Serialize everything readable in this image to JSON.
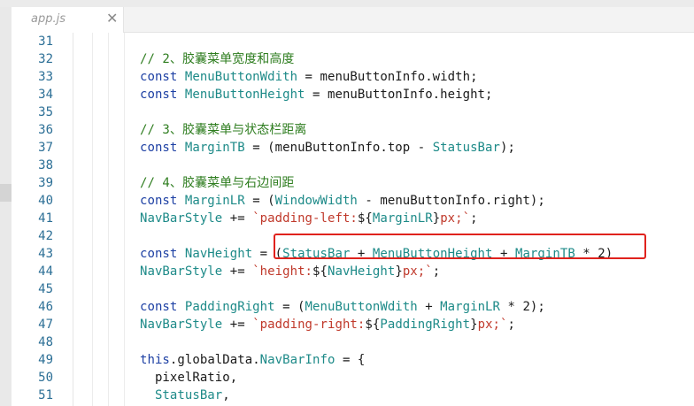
{
  "tab": {
    "title": "app.js",
    "close": "✕"
  },
  "colors": {
    "keyword": "#1c3fa3",
    "identifier": "#1d8a88",
    "string": "#c0392b",
    "comment": "#2e7d1f",
    "plain": "#1a1a1a",
    "line_number": "#2c6f96",
    "highlight_border": "#e0221d"
  },
  "lines": [
    {
      "n": "31",
      "tokens": []
    },
    {
      "n": "32",
      "tokens": [
        {
          "t": "// 2、胶囊菜单宽度和高度",
          "c": "comment"
        }
      ]
    },
    {
      "n": "33",
      "tokens": [
        {
          "t": "const ",
          "c": "keyword"
        },
        {
          "t": "MenuButtonWdith",
          "c": "identifier"
        },
        {
          "t": " = menuButtonInfo.width;",
          "c": "plain"
        }
      ]
    },
    {
      "n": "34",
      "tokens": [
        {
          "t": "const ",
          "c": "keyword"
        },
        {
          "t": "MenuButtonHeight",
          "c": "identifier"
        },
        {
          "t": " = menuButtonInfo.height;",
          "c": "plain"
        }
      ]
    },
    {
      "n": "35",
      "tokens": []
    },
    {
      "n": "36",
      "tokens": [
        {
          "t": "// 3、胶囊菜单与状态栏距离",
          "c": "comment"
        }
      ]
    },
    {
      "n": "37",
      "tokens": [
        {
          "t": "const ",
          "c": "keyword"
        },
        {
          "t": "MarginTB",
          "c": "identifier"
        },
        {
          "t": " = (menuButtonInfo.top - ",
          "c": "plain"
        },
        {
          "t": "StatusBar",
          "c": "identifier"
        },
        {
          "t": ");",
          "c": "plain"
        }
      ]
    },
    {
      "n": "38",
      "tokens": []
    },
    {
      "n": "39",
      "tokens": [
        {
          "t": "// 4、胶囊菜单与右边间距",
          "c": "comment"
        }
      ]
    },
    {
      "n": "40",
      "tokens": [
        {
          "t": "const ",
          "c": "keyword"
        },
        {
          "t": "MarginLR",
          "c": "identifier"
        },
        {
          "t": " = (",
          "c": "plain"
        },
        {
          "t": "WindowWidth",
          "c": "identifier"
        },
        {
          "t": " - menuButtonInfo.right);",
          "c": "plain"
        }
      ]
    },
    {
      "n": "41",
      "tokens": [
        {
          "t": "NavBarStyle",
          "c": "identifier"
        },
        {
          "t": " += ",
          "c": "plain"
        },
        {
          "t": "`padding-left:",
          "c": "string"
        },
        {
          "t": "${",
          "c": "plain"
        },
        {
          "t": "MarginLR",
          "c": "identifier"
        },
        {
          "t": "}",
          "c": "plain"
        },
        {
          "t": "px;`",
          "c": "string"
        },
        {
          "t": ";",
          "c": "plain"
        }
      ]
    },
    {
      "n": "42",
      "tokens": []
    },
    {
      "n": "43",
      "tokens": [
        {
          "t": "const ",
          "c": "keyword"
        },
        {
          "t": "NavHeight",
          "c": "identifier"
        },
        {
          "t": " = (",
          "c": "plain"
        },
        {
          "t": "StatusBar",
          "c": "identifier"
        },
        {
          "t": " + ",
          "c": "plain"
        },
        {
          "t": "MenuButtonHeight",
          "c": "identifier"
        },
        {
          "t": " + ",
          "c": "plain"
        },
        {
          "t": "MarginTB",
          "c": "identifier"
        },
        {
          "t": " * 2)",
          "c": "plain"
        }
      ]
    },
    {
      "n": "44",
      "tokens": [
        {
          "t": "NavBarStyle",
          "c": "identifier"
        },
        {
          "t": " += ",
          "c": "plain"
        },
        {
          "t": "`height:",
          "c": "string"
        },
        {
          "t": "${",
          "c": "plain"
        },
        {
          "t": "NavHeight",
          "c": "identifier"
        },
        {
          "t": "}",
          "c": "plain"
        },
        {
          "t": "px;`",
          "c": "string"
        },
        {
          "t": ";",
          "c": "plain"
        }
      ]
    },
    {
      "n": "45",
      "tokens": []
    },
    {
      "n": "46",
      "tokens": [
        {
          "t": "const ",
          "c": "keyword"
        },
        {
          "t": "PaddingRight",
          "c": "identifier"
        },
        {
          "t": " = (",
          "c": "plain"
        },
        {
          "t": "MenuButtonWdith",
          "c": "identifier"
        },
        {
          "t": " + ",
          "c": "plain"
        },
        {
          "t": "MarginLR",
          "c": "identifier"
        },
        {
          "t": " * 2);",
          "c": "plain"
        }
      ]
    },
    {
      "n": "47",
      "tokens": [
        {
          "t": "NavBarStyle",
          "c": "identifier"
        },
        {
          "t": " += ",
          "c": "plain"
        },
        {
          "t": "`padding-right:",
          "c": "string"
        },
        {
          "t": "${",
          "c": "plain"
        },
        {
          "t": "PaddingRight",
          "c": "identifier"
        },
        {
          "t": "}",
          "c": "plain"
        },
        {
          "t": "px;`",
          "c": "string"
        },
        {
          "t": ";",
          "c": "plain"
        }
      ]
    },
    {
      "n": "48",
      "tokens": []
    },
    {
      "n": "49",
      "tokens": [
        {
          "t": "this",
          "c": "keyword"
        },
        {
          "t": ".globalData.",
          "c": "plain"
        },
        {
          "t": "NavBarInfo",
          "c": "identifier"
        },
        {
          "t": " = {",
          "c": "plain"
        }
      ]
    },
    {
      "n": "50",
      "tokens": [
        {
          "t": "  pixelRatio,",
          "c": "plain"
        }
      ]
    },
    {
      "n": "51",
      "tokens": [
        {
          "t": "  StatusBar",
          "c": "identifier"
        },
        {
          "t": ",",
          "c": "plain"
        }
      ]
    }
  ]
}
